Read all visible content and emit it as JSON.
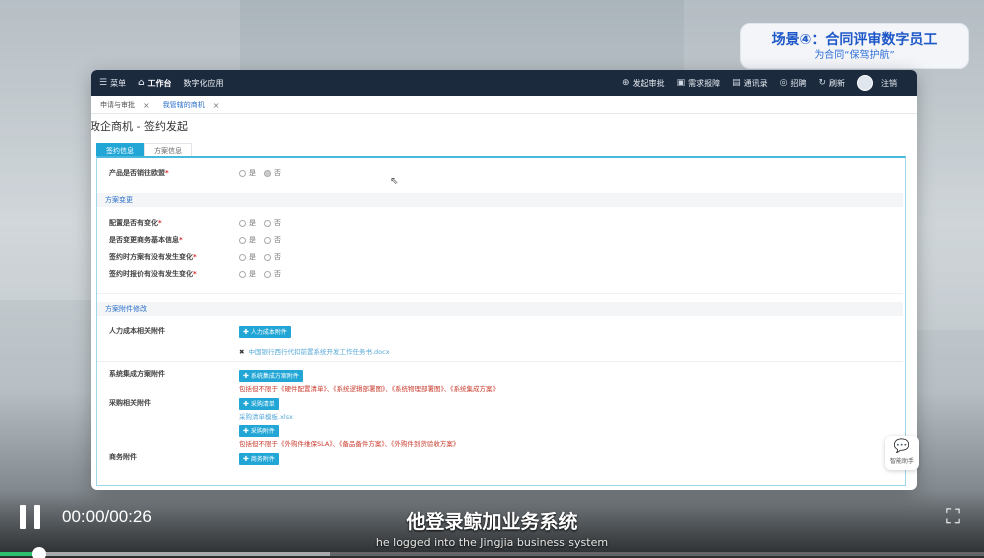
{
  "scene": {
    "title": "场景④：合同评审数字员工",
    "subtitle": "为合同“保驾护航”"
  },
  "topbar": {
    "menu": "菜单",
    "workbench": "工作台",
    "digital_apps": "数字化应用",
    "right_items": [
      "发起审批",
      "需求报障",
      "通讯录",
      "招聘",
      "刷新"
    ],
    "logout": "注销"
  },
  "page_tabs": [
    {
      "label": "申请与审批"
    },
    {
      "label": "我管辖的商机"
    }
  ],
  "page_title": "政企商机 - 签约发起",
  "sub_tabs": [
    "签约信息",
    "方案信息"
  ],
  "radio_options": {
    "yes": "是",
    "no": "否"
  },
  "form": {
    "product_row": {
      "label": "产品是否销往欧盟"
    },
    "section_plan_change": "方案变更",
    "plan_rows": [
      {
        "label": "配置是否有变化"
      },
      {
        "label": "是否变更商务基本信息"
      },
      {
        "label": "签约时方案有没有发生变化"
      },
      {
        "label": "签约时报价有没有发生变化"
      }
    ],
    "section_attachments": "方案附件修改",
    "hr_label": "人力成本相关附件",
    "hr_button": "人力成本附件",
    "hr_file": "中国银行西行代扣前置系统开发工作任务书.docx",
    "sys_label": "系统集成方案附件",
    "sys_button": "系统集成方案附件",
    "sys_note": "包括但不限于《硬件配置清单》、《系统逻辑部署图》、《系统物理部署图》、《系统集成方案》",
    "purchase_label": "采购相关附件",
    "purchase_button1": "采购清单",
    "purchase_file": "采购清单模板.xlsx",
    "purchase_button2": "采购附件",
    "purchase_note": "包括但不限于《外购件维保SLA》、《备品备件方案》、《外购件到货验收方案》",
    "biz_label": "商务附件",
    "biz_button": "商务附件"
  },
  "helper": {
    "label": "智能助手"
  },
  "video": {
    "time": "00:00/00:26",
    "subtitle_cn": "他登录鲸加业务系统",
    "subtitle_en": "he logged into the Jingjia business system",
    "progress_percent": 4
  }
}
